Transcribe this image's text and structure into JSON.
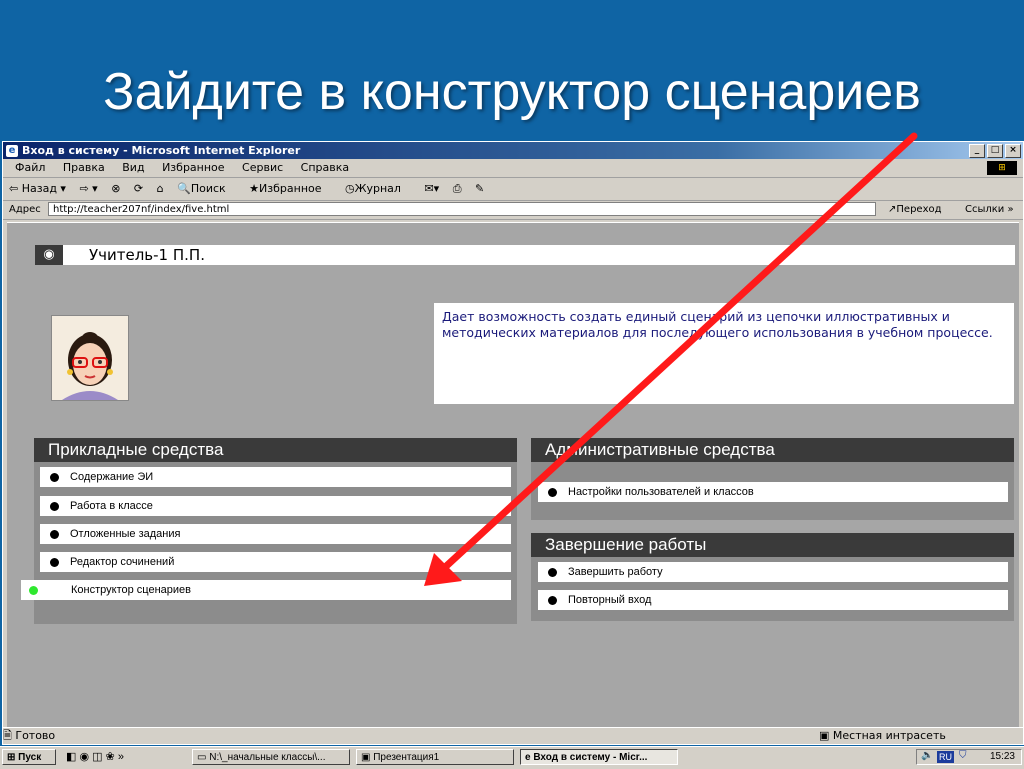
{
  "slide": {
    "title": "Зайдите в конструктор сценариев"
  },
  "window": {
    "title": "Вход в систему - Microsoft Internet Explorer",
    "menu": [
      "Файл",
      "Правка",
      "Вид",
      "Избранное",
      "Сервис",
      "Справка"
    ],
    "toolbar": {
      "back": "⇦ Назад ▾",
      "forward": "⇨ ▾",
      "search": "Поиск",
      "favorites": "Избранное",
      "history": "Журнал"
    },
    "address": {
      "label": "Адрес",
      "url": "http://teacher207nf/index/five.html",
      "go": "Переход",
      "links": "Ссылки"
    }
  },
  "page": {
    "user_name": "Учитель-1  П.П.",
    "info_text": "Дает возможность создать единый сценарий из цепочки иллюстративных и методических материалов для последующего использования в учебном процессе.",
    "applied": {
      "title": "Прикладные средства",
      "items": [
        "Содержание ЭИ",
        "Работа в классе",
        "Отложенные задания",
        "Редактор сочинений",
        "Конструктор сценариев"
      ]
    },
    "admin": {
      "title": "Административные средства",
      "items": [
        "Настройки пользователей и классов"
      ]
    },
    "finish": {
      "title": "Завершение работы",
      "items": [
        "Завершить работу",
        "Повторный вход"
      ]
    }
  },
  "statusbar": {
    "left": "Готово",
    "zone": "Местная интрасеть"
  },
  "taskbar": {
    "start": "Пуск",
    "buttons": [
      "N:\\_начальные классы\\...",
      "Презентация1",
      "Вход в систему - Micr..."
    ],
    "lang": "RU",
    "clock": "15:23"
  },
  "colors": {
    "slide_bg": "#0f64a4",
    "arrow": "#ff1a1a",
    "panel_head": "#3a3a3a"
  }
}
